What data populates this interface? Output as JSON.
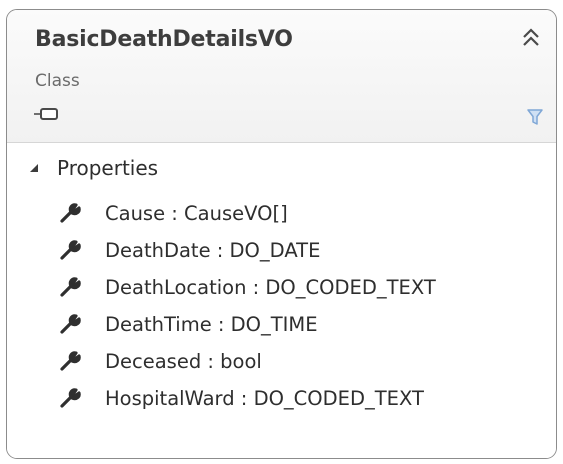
{
  "class_shape": {
    "title": "BasicDeathDetailsVO",
    "stereotype": "Class",
    "icons": {
      "collapse": "double-chevron-up-icon",
      "class": "class-box-icon",
      "filter": "filter-funnel-icon"
    },
    "colors": {
      "border": "#8c8c8c",
      "title": "#3d3d3d",
      "filter": "#7fa7d6",
      "wrench": "#2f2f2f"
    }
  },
  "sections": [
    {
      "label": "Properties",
      "expanded": true,
      "items": [
        {
          "text": "Cause : CauseVO[]",
          "icon": "wrench-icon"
        },
        {
          "text": "DeathDate : DO_DATE",
          "icon": "wrench-icon"
        },
        {
          "text": "DeathLocation : DO_CODED_TEXT",
          "icon": "wrench-icon"
        },
        {
          "text": "DeathTime : DO_TIME",
          "icon": "wrench-icon"
        },
        {
          "text": "Deceased : bool",
          "icon": "wrench-icon"
        },
        {
          "text": "HospitalWard : DO_CODED_TEXT",
          "icon": "wrench-icon"
        }
      ]
    }
  ]
}
